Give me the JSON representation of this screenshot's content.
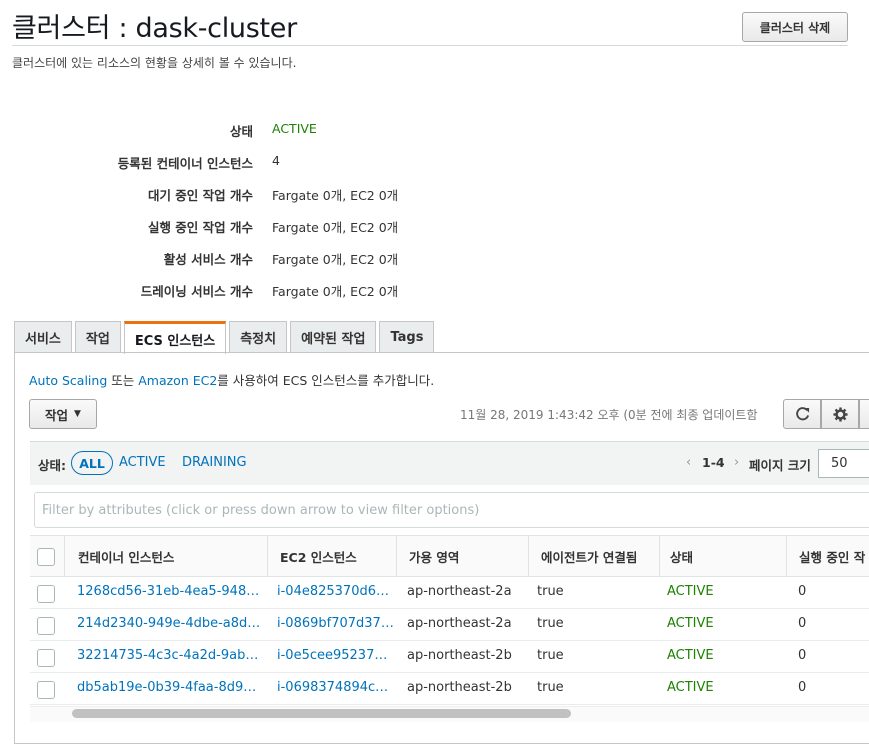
{
  "header": {
    "title": "클러스터 : dask-cluster",
    "delete_label": "클러스터 삭제",
    "subtitle": "클러스터에 있는 리소스의 현황을 상세히 볼 수 있습니다."
  },
  "details": [
    {
      "label": "상태",
      "value": "ACTIVE"
    },
    {
      "label": "등록된 컨테이너 인스턴스",
      "value": "4"
    },
    {
      "label": "대기 중인 작업 개수",
      "value": "Fargate 0개, EC2 0개"
    },
    {
      "label": "실행 중인 작업 개수",
      "value": "Fargate 0개, EC2 0개"
    },
    {
      "label": "활성 서비스 개수",
      "value": "Fargate 0개, EC2 0개"
    },
    {
      "label": "드레이닝 서비스 개수",
      "value": "Fargate 0개, EC2 0개"
    }
  ],
  "tabs": [
    {
      "label": "서비스"
    },
    {
      "label": "작업"
    },
    {
      "label": "ECS 인스턴스",
      "active": true
    },
    {
      "label": "측정치"
    },
    {
      "label": "예약된 작업"
    },
    {
      "label": "Tags"
    }
  ],
  "info": {
    "link1": "Auto Scaling",
    "text1": " 또는 ",
    "link2": "Amazon EC2",
    "text2": "를 사용하여 ECS 인스턴스를 추가합니다."
  },
  "toolbar": {
    "actions_label": "작업",
    "last_updated": "11월 28, 2019 1:43:42 오후 (0분 전에 최종 업데이트함",
    "refresh_icon": "refresh-icon",
    "settings_icon": "gear-icon"
  },
  "filter": {
    "label": "상태:",
    "options": [
      "ALL",
      "ACTIVE",
      "DRAINING"
    ],
    "selected": "ALL",
    "page_range": "1-4",
    "page_size_label": "페이지 크기",
    "page_size": "50",
    "search_placeholder": "Filter by attributes (click or press down arrow to view filter options)"
  },
  "table": {
    "columns": [
      "컨테이너 인스턴스",
      "EC2 인스턴스",
      "가용 영역",
      "에이전트가 연결됨",
      "상태",
      "실행 중인 작"
    ],
    "rows": [
      {
        "container": "1268cd56-31eb-4ea5-948…",
        "ec2": "i-04e825370d6…",
        "az": "ap-northeast-2a",
        "agent": "true",
        "status": "ACTIVE",
        "running": "0"
      },
      {
        "container": "214d2340-949e-4dbe-a8d…",
        "ec2": "i-0869bf707d37…",
        "az": "ap-northeast-2a",
        "agent": "true",
        "status": "ACTIVE",
        "running": "0"
      },
      {
        "container": "32214735-4c3c-4a2d-9ab…",
        "ec2": "i-0e5cee95237…",
        "az": "ap-northeast-2b",
        "agent": "true",
        "status": "ACTIVE",
        "running": "0"
      },
      {
        "container": "db5ab19e-0b39-4faa-8d9…",
        "ec2": "i-0698374894c…",
        "az": "ap-northeast-2b",
        "agent": "true",
        "status": "ACTIVE",
        "running": "0"
      }
    ]
  },
  "colors": {
    "accent": "#ec7211",
    "link": "#0073bb",
    "active_status": "#1d8102"
  }
}
